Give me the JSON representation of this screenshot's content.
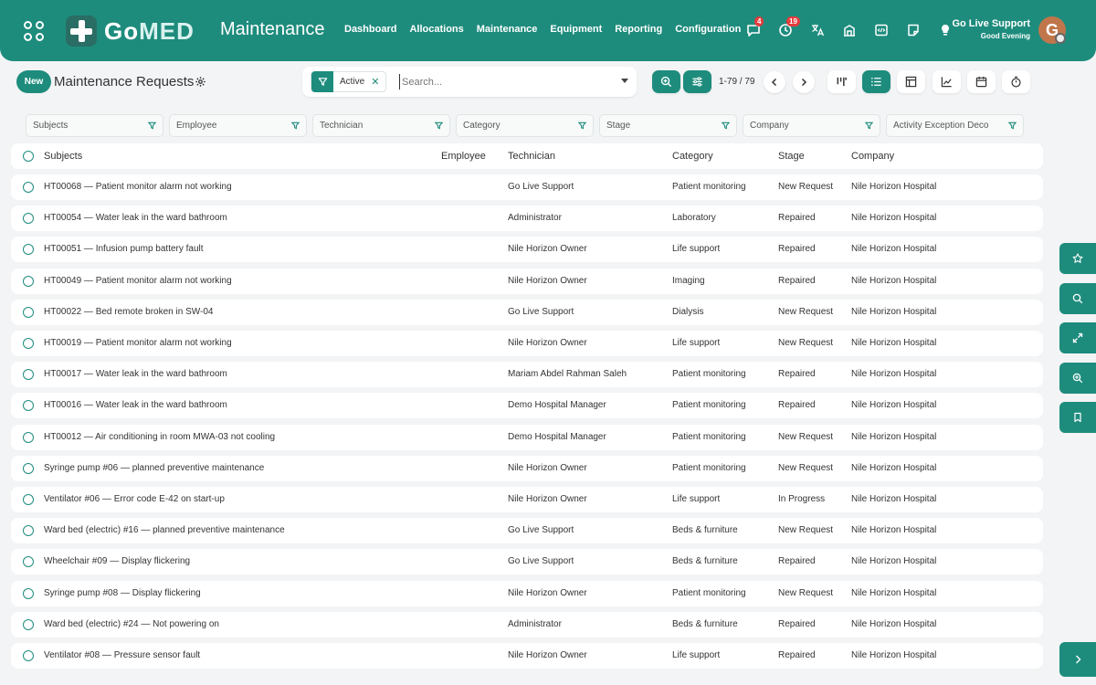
{
  "header": {
    "logo_text_a": "Go",
    "logo_text_b": "MED",
    "app_title": "Maintenance",
    "nav": [
      "Dashboard",
      "Allocations",
      "Maintenance",
      "Equipment",
      "Reporting",
      "Configuration"
    ],
    "messages_count": "4",
    "activities_count": "19",
    "user_name": "Go Live Support",
    "user_greeting": "Good Evening",
    "avatar_letter": "G"
  },
  "toolbar": {
    "new_label": "New",
    "page_title": "Maintenance Requests",
    "facet_label": "Active",
    "search_placeholder": "Search...",
    "pager": "1-79 / 79"
  },
  "column_filters": [
    "Subjects",
    "Employee",
    "Technician",
    "Category",
    "Stage",
    "Company",
    "Activity Exception Deco"
  ],
  "table": {
    "headers": {
      "subject": "Subjects",
      "employee": "Employee",
      "technician": "Technician",
      "category": "Category",
      "stage": "Stage",
      "company": "Company"
    },
    "rows": [
      {
        "subject": "HT00068 — Patient monitor alarm not working",
        "technician": "Go Live Support",
        "category": "Patient monitoring",
        "stage": "New Request",
        "company": "Nile Horizon Hospital"
      },
      {
        "subject": "HT00054 — Water leak in the ward bathroom",
        "technician": "Administrator",
        "category": "Laboratory",
        "stage": "Repaired",
        "company": "Nile Horizon Hospital"
      },
      {
        "subject": "HT00051 — Infusion pump battery fault",
        "technician": "Nile Horizon Owner",
        "category": "Life support",
        "stage": "Repaired",
        "company": "Nile Horizon Hospital"
      },
      {
        "subject": "HT00049 — Patient monitor alarm not working",
        "technician": "Nile Horizon Owner",
        "category": "Imaging",
        "stage": "Repaired",
        "company": "Nile Horizon Hospital"
      },
      {
        "subject": "HT00022 — Bed remote broken in SW-04",
        "technician": "Go Live Support",
        "category": "Dialysis",
        "stage": "New Request",
        "company": "Nile Horizon Hospital"
      },
      {
        "subject": "HT00019 — Patient monitor alarm not working",
        "technician": "Nile Horizon Owner",
        "category": "Life support",
        "stage": "New Request",
        "company": "Nile Horizon Hospital"
      },
      {
        "subject": "HT00017 — Water leak in the ward bathroom",
        "technician": "Mariam Abdel Rahman Saleh",
        "category": "Patient monitoring",
        "stage": "Repaired",
        "company": "Nile Horizon Hospital"
      },
      {
        "subject": "HT00016 — Water leak in the ward bathroom",
        "technician": "Demo Hospital Manager",
        "category": "Patient monitoring",
        "stage": "Repaired",
        "company": "Nile Horizon Hospital"
      },
      {
        "subject": "HT00012 — Air conditioning in room MWA-03 not cooling",
        "technician": "Demo Hospital Manager",
        "category": "Patient monitoring",
        "stage": "New Request",
        "company": "Nile Horizon Hospital"
      },
      {
        "subject": "Syringe pump #06 — planned preventive maintenance",
        "technician": "Nile Horizon Owner",
        "category": "Patient monitoring",
        "stage": "New Request",
        "company": "Nile Horizon Hospital"
      },
      {
        "subject": "Ventilator #06 — Error code E-42 on start-up",
        "technician": "Nile Horizon Owner",
        "category": "Life support",
        "stage": "In Progress",
        "company": "Nile Horizon Hospital"
      },
      {
        "subject": "Ward bed (electric) #16 — planned preventive maintenance",
        "technician": "Go Live Support",
        "category": "Beds & furniture",
        "stage": "New Request",
        "company": "Nile Horizon Hospital"
      },
      {
        "subject": "Wheelchair #09 — Display flickering",
        "technician": "Go Live Support",
        "category": "Beds & furniture",
        "stage": "Repaired",
        "company": "Nile Horizon Hospital"
      },
      {
        "subject": "Syringe pump #08 — Display flickering",
        "technician": "Nile Horizon Owner",
        "category": "Patient monitoring",
        "stage": "New Request",
        "company": "Nile Horizon Hospital"
      },
      {
        "subject": "Ward bed (electric) #24 — Not powering on",
        "technician": "Administrator",
        "category": "Beds & furniture",
        "stage": "Repaired",
        "company": "Nile Horizon Hospital"
      },
      {
        "subject": "Ventilator #08 — Pressure sensor fault",
        "technician": "Nile Horizon Owner",
        "category": "Life support",
        "stage": "Repaired",
        "company": "Nile Horizon Hospital"
      }
    ]
  },
  "side_buttons": [
    "star-icon",
    "search-icon",
    "expand-icon",
    "zoom-in-icon",
    "bookmark-icon"
  ],
  "colors": {
    "accent": "#1e8c7d",
    "badge": "#e43c3c",
    "background": "#f2f4f5"
  }
}
